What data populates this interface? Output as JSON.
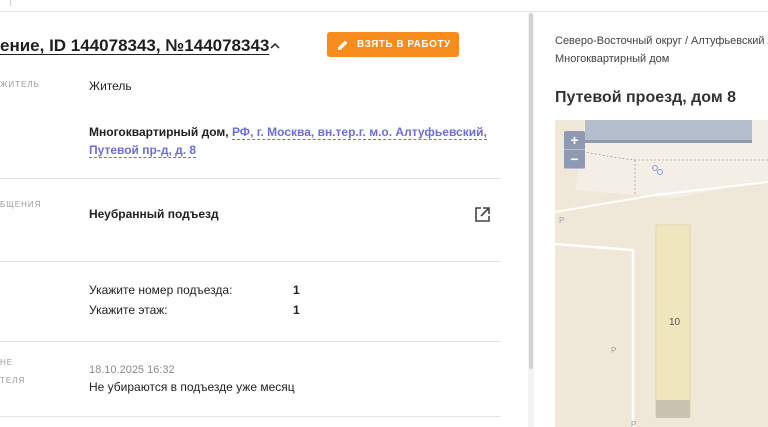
{
  "header": {
    "title": "ение, ID 144078343, №144078343",
    "take_button": "ВЗЯТЬ В РАБОТУ"
  },
  "details": {
    "author_label": "ЖИТЕЛЬ",
    "author_value": "Житель",
    "object_prefix": "Многоквартирный дом,",
    "object_address": "РФ, г. Москва, вн.тер.г. м.о. Алтуфьевский, Путевой пр-д, д. 8",
    "problem_label": "БЩЕНИЯ",
    "problem_value": "Неубранный подъезд",
    "entrance_label": "Укажите номер подъезда:",
    "entrance_value": "1",
    "floor_label": "Укажите этаж:",
    "floor_value": "1",
    "comment_label_1": "НЕ",
    "comment_label_2": "ТЕЛЯ",
    "comment_date": "18.10.2025 16:32",
    "comment_text": "Не убираются в подъезде уже месяц"
  },
  "sidebar": {
    "breadcrumb_line1": "Северо-Восточный округ / Алтуфьевский /",
    "breadcrumb_line2": "Многоквартирный дом",
    "place_title": "Путевой проезд, дом 8"
  },
  "map": {
    "zoom_in": "+",
    "zoom_out": "−",
    "building_number": "10",
    "poi_parking": "P"
  },
  "colors": {
    "accent": "#f78b1c",
    "link": "#6b6ed6",
    "map_bg": "#efe8d9",
    "zoom_bg": "#8e9ab1"
  }
}
